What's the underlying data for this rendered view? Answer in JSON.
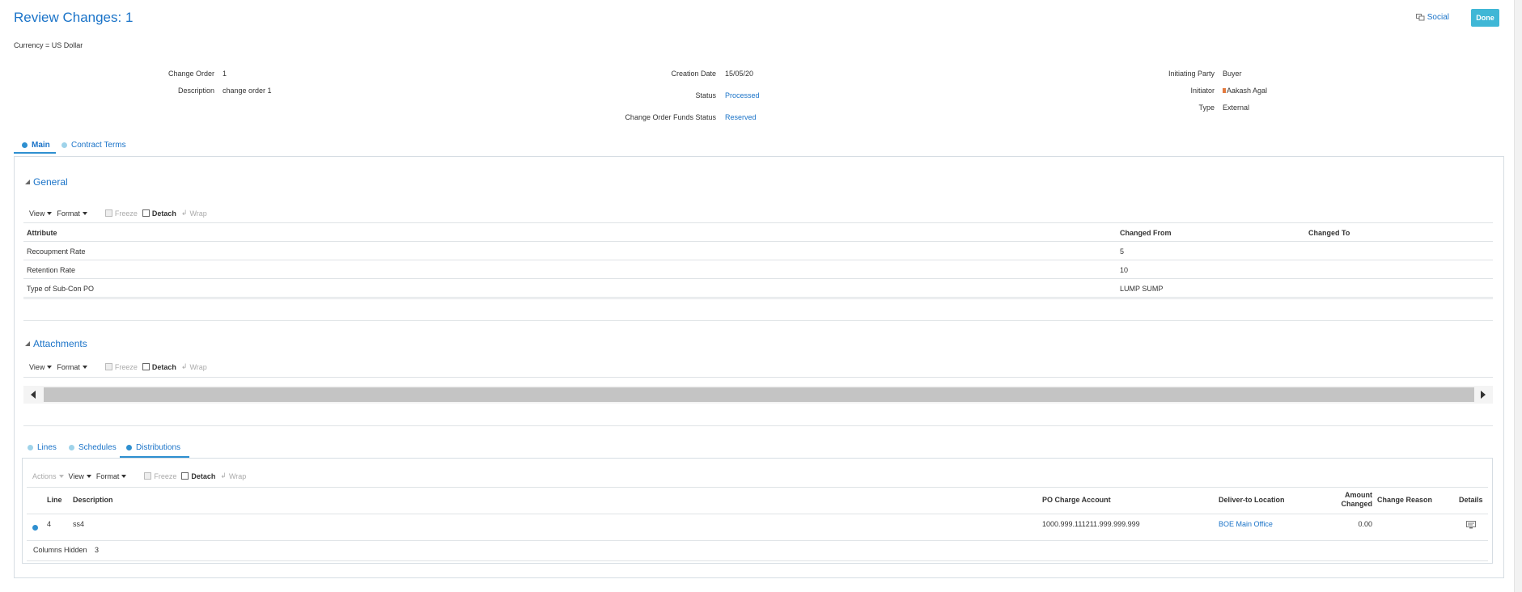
{
  "header": {
    "title": "Review Changes: 1",
    "social_label": "Social",
    "done_label": "Done",
    "currency": "Currency = US Dollar"
  },
  "summary": {
    "change_order_label": "Change Order",
    "change_order_value": "1",
    "description_label": "Description",
    "description_value": "change order 1",
    "creation_date_label": "Creation Date",
    "creation_date_value": "15/05/20",
    "status_label": "Status",
    "status_value": "Processed",
    "funds_status_label": "Change Order Funds Status",
    "funds_status_value": "Reserved",
    "initiating_party_label": "Initiating Party",
    "initiating_party_value": "Buyer",
    "initiator_label": "Initiator",
    "initiator_value": "Aakash Agal",
    "type_label": "Type",
    "type_value": "External"
  },
  "tabs": [
    {
      "label": "Main",
      "active": true
    },
    {
      "label": "Contract Terms",
      "active": false
    }
  ],
  "toolbar": {
    "view": "View",
    "format": "Format",
    "freeze": "Freeze",
    "detach": "Detach",
    "wrap": "Wrap",
    "actions": "Actions"
  },
  "general": {
    "title": "General",
    "columns": [
      "Attribute",
      "Changed From",
      "Changed To"
    ],
    "rows": [
      {
        "attribute": "Recoupment Rate",
        "from": "5",
        "to": ""
      },
      {
        "attribute": "Retention Rate",
        "from": "10",
        "to": ""
      },
      {
        "attribute": "Type of Sub-Con PO",
        "from": "LUMP SUMP",
        "to": ""
      }
    ]
  },
  "attachments": {
    "title": "Attachments"
  },
  "bottom_tabs": [
    {
      "label": "Lines",
      "active": false
    },
    {
      "label": "Schedules",
      "active": false
    },
    {
      "label": "Distributions",
      "active": true
    }
  ],
  "distributions": {
    "columns": {
      "line": "Line",
      "description": "Description",
      "po_charge_account": "PO Charge Account",
      "deliver_to": "Deliver-to Location",
      "amount_changed_1": "Amount",
      "amount_changed_2": "Changed",
      "change_reason": "Change Reason",
      "details": "Details"
    },
    "rows": [
      {
        "line": "4",
        "description": "ss4",
        "po_charge_account": "1000.999.111211.999.999.999",
        "deliver_to": "BOE Main Office",
        "amount_changed": "0.00",
        "change_reason": ""
      }
    ],
    "columns_hidden_label": "Columns Hidden",
    "columns_hidden_value": "3"
  },
  "colors": {
    "accent": "#1a73c8",
    "done_button": "#3fb7d6"
  }
}
